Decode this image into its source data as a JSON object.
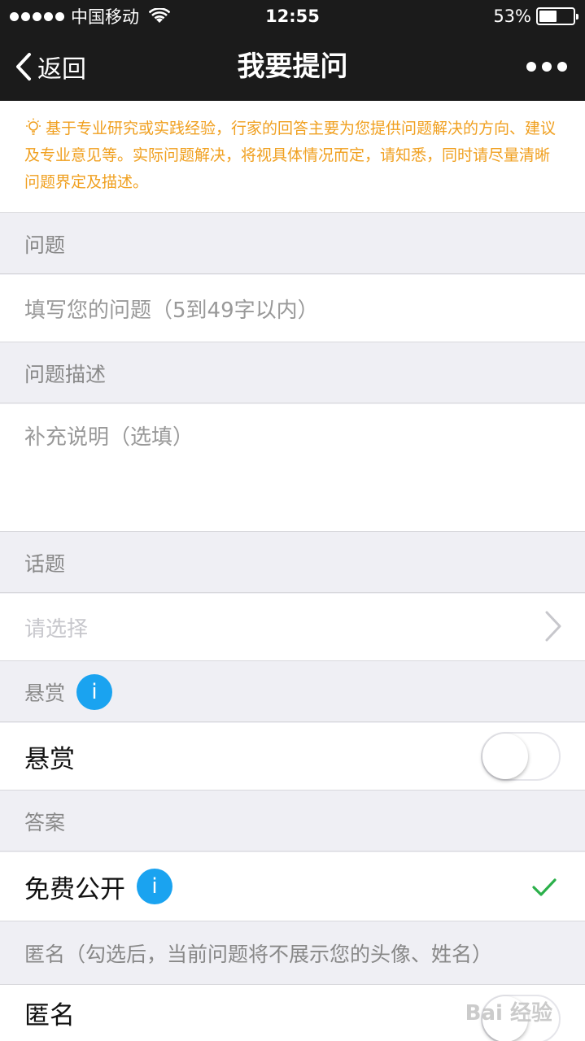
{
  "status_bar": {
    "carrier": "中国移动",
    "time": "12:55",
    "battery": "53%",
    "battery_level": 0.53
  },
  "nav": {
    "back_label": "返回",
    "title": "我要提问"
  },
  "notice": {
    "text": "基于专业研究或实践经验，行家的回答主要为您提供问题解决的方向、建议及专业意见等。实际问题解决，将视具体情况而定，请知悉，同时请尽量清晰问题界定及描述。"
  },
  "question": {
    "header": "问题",
    "placeholder": "填写您的问题（5到49字以内）"
  },
  "description": {
    "header": "问题描述",
    "placeholder": "补充说明（选填）"
  },
  "topic": {
    "header": "话题",
    "placeholder": "请选择"
  },
  "reward": {
    "header": "悬赏",
    "info_glyph": "i",
    "row_label": "悬赏",
    "enabled": false
  },
  "answer": {
    "header": "答案",
    "row_label": "免费公开",
    "info_glyph": "i",
    "selected": true
  },
  "anonymous": {
    "header": "匿名（勾选后，当前问题将不展示您的头像、姓名）",
    "row_label": "匿名",
    "enabled": false
  },
  "watermark": {
    "text": "Bai 经验"
  },
  "colors": {
    "notice_text": "#f0a020",
    "info_icon": "#1aa3f0",
    "check": "#2bb04a",
    "nav_bg": "#1b1b1b"
  }
}
